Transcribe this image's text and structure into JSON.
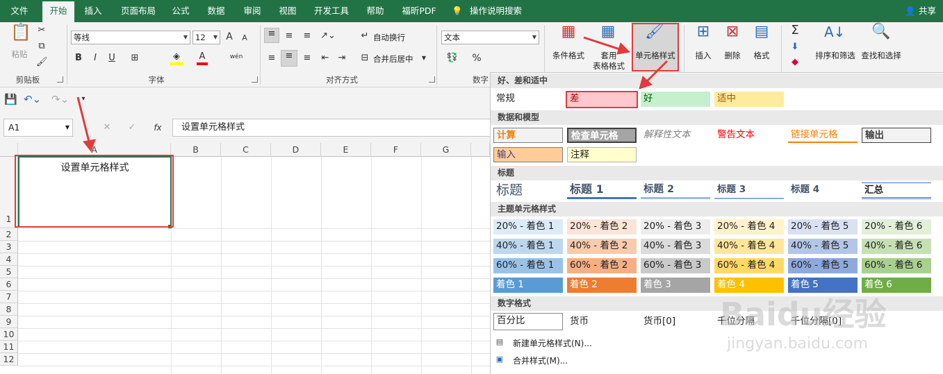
{
  "tabs": [
    "文件",
    "开始",
    "插入",
    "页面布局",
    "公式",
    "数据",
    "审阅",
    "视图",
    "开发工具",
    "帮助",
    "福昕PDF",
    "操作说明搜索"
  ],
  "share": "共享",
  "ribbon": {
    "clipboard": {
      "paste": "粘贴",
      "label": "剪贴板"
    },
    "font": {
      "name": "等线",
      "size": "12",
      "bold": "B",
      "italic": "I",
      "underline": "U",
      "grow": "A",
      "shrink": "A",
      "wen": "wén",
      "label": "字体"
    },
    "align": {
      "wrap": "自动换行",
      "merge": "合并后居中",
      "label": "对齐方式"
    },
    "number": {
      "format": "文本",
      "percent": "%",
      "comma": ",",
      "label": "数字"
    },
    "styles": {
      "cond": "条件格式",
      "table1": "套用",
      "table2": "表格格式",
      "cell": "单元格样式"
    },
    "cells": {
      "insert": "插入",
      "delete": "删除",
      "format": "格式"
    },
    "edit": {
      "sort": "排序和筛选",
      "find": "查找和选择",
      "sum": "Σ"
    }
  },
  "formula": {
    "namebox": "A1",
    "fx": "fx",
    "content": "设置单元格样式"
  },
  "columns": [
    "A",
    "B",
    "C",
    "D",
    "E",
    "F",
    "G"
  ],
  "rows": [
    "1",
    "2",
    "3",
    "4",
    "5",
    "6",
    "7",
    "8",
    "9",
    "10",
    "11",
    "12"
  ],
  "cell_a1": "设置单元格样式",
  "dropdown": {
    "sec_good": "好、差和适中",
    "normal": "常规",
    "bad": "差",
    "good": "好",
    "neutral": "适中",
    "sec_data": "数据和模型",
    "calc": "计算",
    "check": "检查单元格",
    "explan": "解释性文本",
    "warn": "警告文本",
    "linked": "链接单元格",
    "output": "输出",
    "input": "输入",
    "note": "注释",
    "sec_title": "标题",
    "t0": "标题",
    "t1": "标题 1",
    "t2": "标题 2",
    "t3": "标题 3",
    "t4": "标题 4",
    "total": "汇总",
    "sec_theme": "主题单元格样式",
    "r20": [
      "20% - 着色 1",
      "20% - 着色 2",
      "20% - 着色 3",
      "20% - 着色 4",
      "20% - 着色 5",
      "20% - 着色 6"
    ],
    "r40": [
      "40% - 着色 1",
      "40% - 着色 2",
      "40% - 着色 3",
      "40% - 着色 4",
      "40% - 着色 5",
      "40% - 着色 6"
    ],
    "r60": [
      "60% - 着色 1",
      "60% - 着色 2",
      "60% - 着色 3",
      "60% - 着色 4",
      "60% - 着色 5",
      "60% - 着色 6"
    ],
    "r100": [
      "着色 1",
      "着色 2",
      "着色 3",
      "着色 4",
      "着色 5",
      "着色 6"
    ],
    "sec_num": "数字格式",
    "nums": [
      "百分比",
      "货币",
      "货币[0]",
      "千位分隔",
      "千位分隔[0]"
    ],
    "new_style": "新建单元格样式(N)...",
    "merge_style": "合并样式(M)..."
  },
  "watermark": {
    "brand": "Baidu经验",
    "url": "jingyan.baidu.com"
  },
  "colors": {
    "excel_green": "#217346",
    "highlight": "#e23b3b",
    "accent1": "#5b9bd5",
    "accent2": "#ed7d31",
    "accent3": "#a5a5a5",
    "accent4": "#ffc000",
    "accent5": "#4472c4",
    "accent6": "#70ad47"
  }
}
